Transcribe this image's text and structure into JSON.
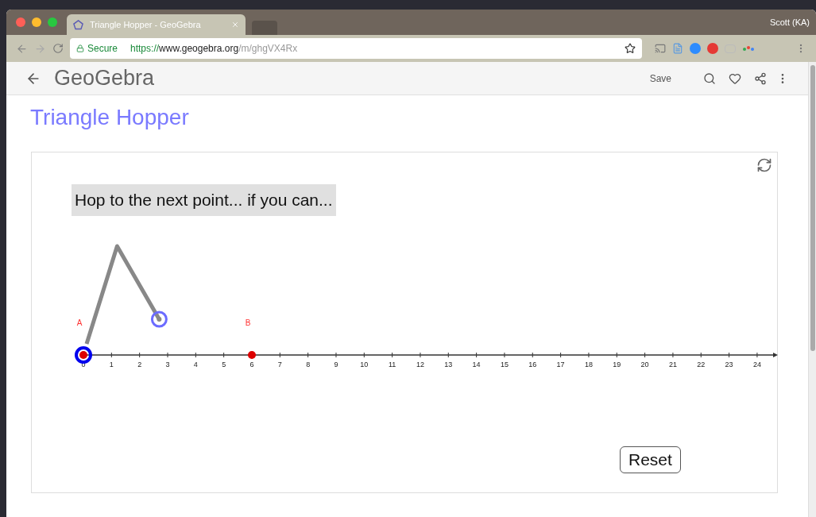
{
  "browser": {
    "tab_title": "Triangle Hopper - GeoGebra",
    "profile": "Scott (KA)",
    "secure_label": "Secure",
    "url_scheme": "https://",
    "url_host": "www.geogebra.org",
    "url_path": "/m/ghgVX4Rx"
  },
  "header": {
    "logo": "GeoGebra",
    "save": "Save"
  },
  "page_title": "Triangle Hopper",
  "applet": {
    "prompt": "Hop to the next point... if you can...",
    "reset": "Reset",
    "points": [
      {
        "label": "A"
      },
      {
        "label": "B"
      }
    ],
    "ticks": [
      "0",
      "1",
      "2",
      "3",
      "4",
      "5",
      "6",
      "7",
      "8",
      "9",
      "10",
      "11",
      "12",
      "13",
      "14",
      "15",
      "16",
      "17",
      "18",
      "19",
      "20",
      "21",
      "22",
      "23",
      "24"
    ]
  }
}
